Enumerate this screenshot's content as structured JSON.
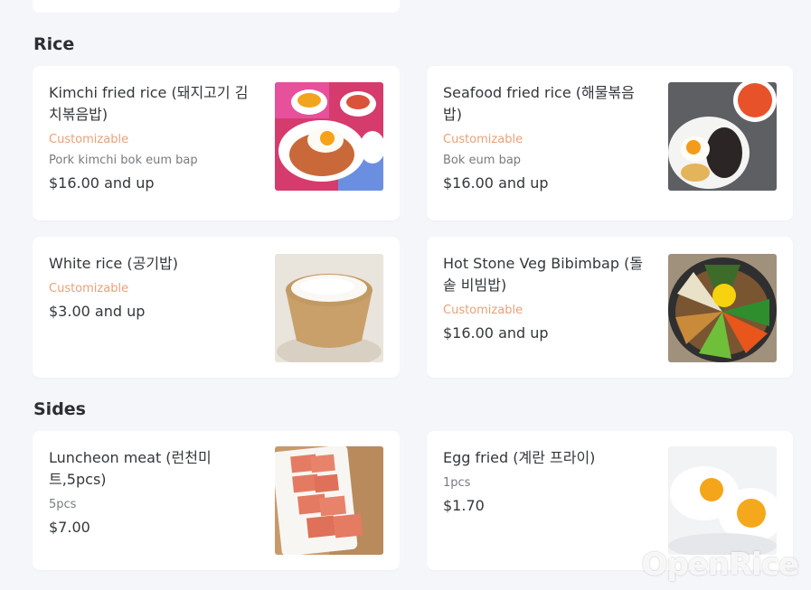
{
  "sections": [
    {
      "title": "Rice",
      "items": [
        {
          "name": "Kimchi fried rice (돼지고기 김치볶음밥)",
          "customizable": "Customizable",
          "description": "Pork kimchi bok eum bap",
          "price": "$16.00 and up",
          "image_icon": "kimchi-fried-rice-image"
        },
        {
          "name": "Seafood fried rice (해물볶음밥)",
          "customizable": "Customizable",
          "description": "Bok eum bap",
          "price": "$16.00 and up",
          "image_icon": "seafood-fried-rice-image"
        },
        {
          "name": "White rice (공기밥)",
          "customizable": "Customizable",
          "price": "$3.00 and up",
          "image_icon": "white-rice-image"
        },
        {
          "name": "Hot Stone Veg Bibimbap (돌솥 비빔밥)",
          "customizable": "Customizable",
          "price": "$16.00 and up",
          "image_icon": "bibimbap-image"
        }
      ]
    },
    {
      "title": "Sides",
      "items": [
        {
          "name": "Luncheon meat (런천미트,5pcs)",
          "description": "5pcs",
          "price": "$7.00",
          "image_icon": "luncheon-meat-image"
        },
        {
          "name": "Egg fried (계란 프라이)",
          "description": "1pcs",
          "price": "$1.70",
          "image_icon": "fried-egg-image"
        }
      ]
    }
  ],
  "watermark": "OpenRice",
  "colors": {
    "customizable": "#e8a07a",
    "background": "#f5f6fa",
    "card": "#ffffff"
  }
}
